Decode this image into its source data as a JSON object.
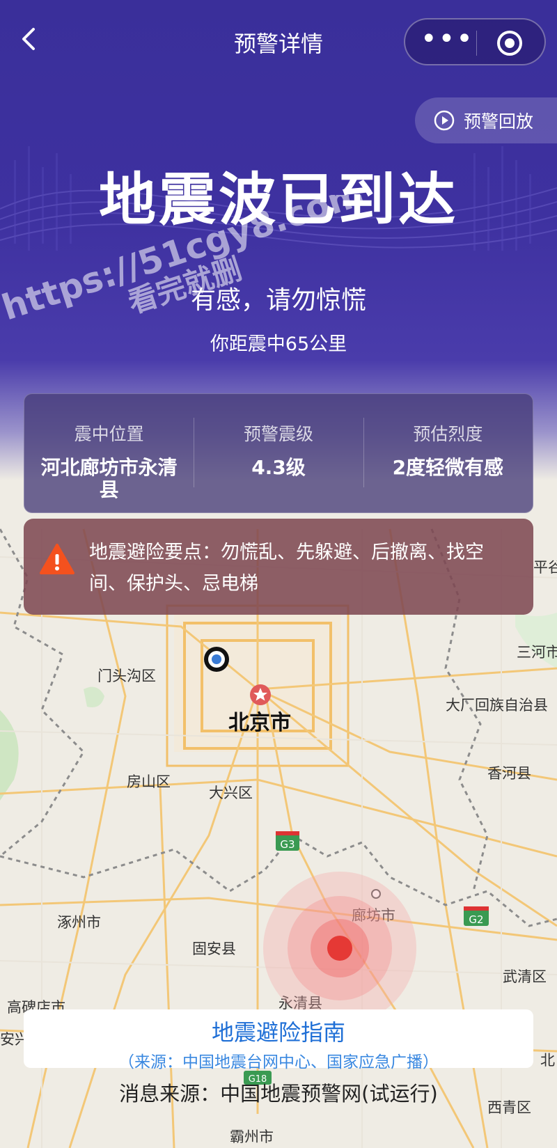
{
  "nav": {
    "title": "预警详情",
    "more": "•••"
  },
  "replay_label": "预警回放",
  "hero": {
    "title": "地震波已到达",
    "subtitle": "有感，请勿惊慌",
    "distance": "你距震中65公里"
  },
  "watermark": {
    "line1": "https://51cgy8.com",
    "line2": "看完就删"
  },
  "info": {
    "location_label": "震中位置",
    "location_value": "河北廊坊市永清县",
    "magnitude_label": "预警震级",
    "magnitude_value": "4.3级",
    "intensity_label": "预估烈度",
    "intensity_value": "2度轻微有感"
  },
  "tip": {
    "text": "地震避险要点：勿慌乱、先躲避、后撤离、找空间、保护头、忌电梯"
  },
  "map": {
    "labels": {
      "mentougou": "门头沟区",
      "beijing": "北京市",
      "fangshan": "房山区",
      "daxing": "大兴区",
      "zhuozhou": "涿州市",
      "guan": "固安县",
      "langfang": "廊坊市",
      "yongqing": "永清县",
      "gaobeidian": "高碑店市",
      "bazhou": "霸州市",
      "pinggu": "平谷",
      "sanhe": "三河市",
      "dachang": "大厂回族自治县",
      "xianghe": "香河县",
      "wuqing": "武清区",
      "xiqing": "西青区",
      "bei": "北",
      "xiongxian": "安兴"
    },
    "roads": {
      "g3": "G3",
      "g2": "G2",
      "g18": "G18"
    }
  },
  "guide": {
    "title": "地震避险指南",
    "source": "（来源：中国地震台网中心、国家应急广播）"
  },
  "msg_source": "消息来源：中国地震预警网(试运行)",
  "colors": {
    "hero_bg": "#3a2f9a",
    "epicenter": "#e53935",
    "guide_link": "#1f6fd6",
    "warning": "#f4511e"
  }
}
